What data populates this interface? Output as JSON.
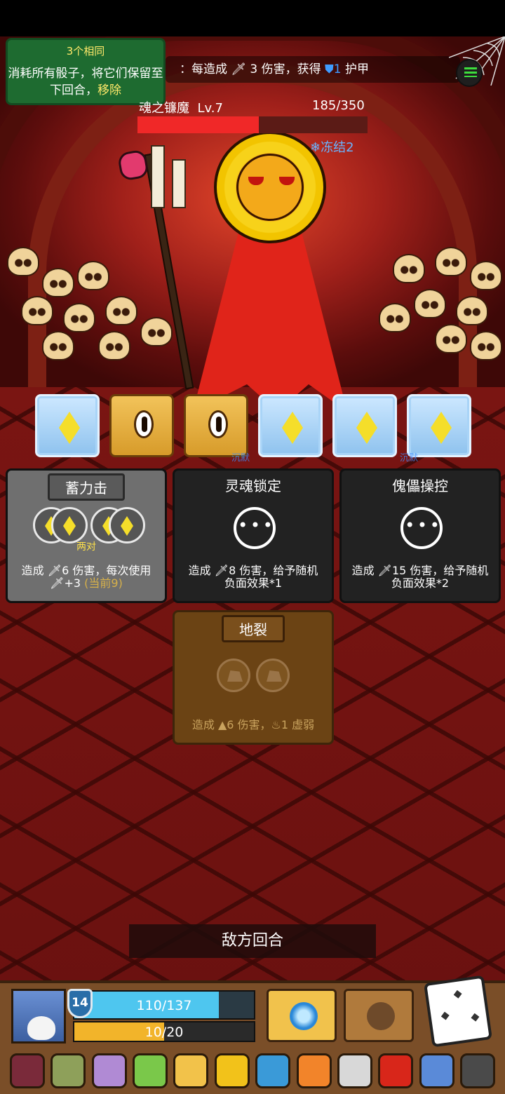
{
  "hint_popup": {
    "title": "3个相同",
    "text": "消耗所有骰子，将它们保留至下回合，",
    "remove_label": "移除"
  },
  "buff_bar": {
    "prefix": "：每造成",
    "mid": "3 伤害，获得",
    "num": "1",
    "suffix": "护甲"
  },
  "boss": {
    "name": "魂之镰魔",
    "level": "Lv.7",
    "hp_text": "185/350",
    "hp": 185,
    "hp_max": 350,
    "status": "冻结2"
  },
  "dice": [
    {
      "type": "frozen-diamond"
    },
    {
      "type": "locked"
    },
    {
      "type": "locked"
    },
    {
      "type": "frozen-diamond"
    },
    {
      "type": "frozen-diamond"
    },
    {
      "type": "frozen-diamond"
    }
  ],
  "silence_labels": [
    "沉默",
    "沉默"
  ],
  "cards": [
    {
      "title": "蓄力击",
      "tag": "两对",
      "desc1": "造成 ",
      "dmg": "6",
      "desc2": " 伤害，每次使用",
      "desc3": "+3 ",
      "current": "(当前9)"
    },
    {
      "title": "灵魂锁定",
      "desc1": "造成 ",
      "dmg": "8",
      "desc2": " 伤害，给予随机",
      "desc3": "负面效果*1"
    },
    {
      "title": "傀儡操控",
      "desc1": "造成 ",
      "dmg": "15",
      "desc2": " 伤害，给予随机",
      "desc3": "负面效果*2"
    },
    {
      "title": "地裂",
      "desc1": "造成 ",
      "dmg": "6",
      "desc2": " 伤害，",
      "weak": "1",
      "desc3": " 虚弱"
    }
  ],
  "turn_label": "敌方回合",
  "player": {
    "shield": "14",
    "hp_text": "110/137",
    "hp": 110,
    "hp_max": 137,
    "xp_text": "10/20",
    "xp": 10,
    "xp_max": 20
  },
  "relics": [
    {
      "icon": "spellbook-icon",
      "color": "#7a2a3a"
    },
    {
      "icon": "mask-icon",
      "color": "#8ea05a"
    },
    {
      "icon": "boot-icon",
      "color": "#b08ad4"
    },
    {
      "icon": "leaf-icon",
      "color": "#7ac84a"
    },
    {
      "icon": "mushroom-icon",
      "color": "#f2c24a"
    },
    {
      "icon": "crown-icon",
      "color": "#f2c21a"
    },
    {
      "icon": "amulet-icon",
      "color": "#3a9ad8"
    },
    {
      "icon": "flame-icon",
      "color": "#f2842a"
    },
    {
      "icon": "wand-icon",
      "color": "#d8d8d8"
    },
    {
      "icon": "ring-icon",
      "color": "#d8261a"
    },
    {
      "icon": "orb-icon",
      "color": "#5a8ad8"
    },
    {
      "icon": "skull-book-icon",
      "color": "#4a4a4a"
    }
  ]
}
